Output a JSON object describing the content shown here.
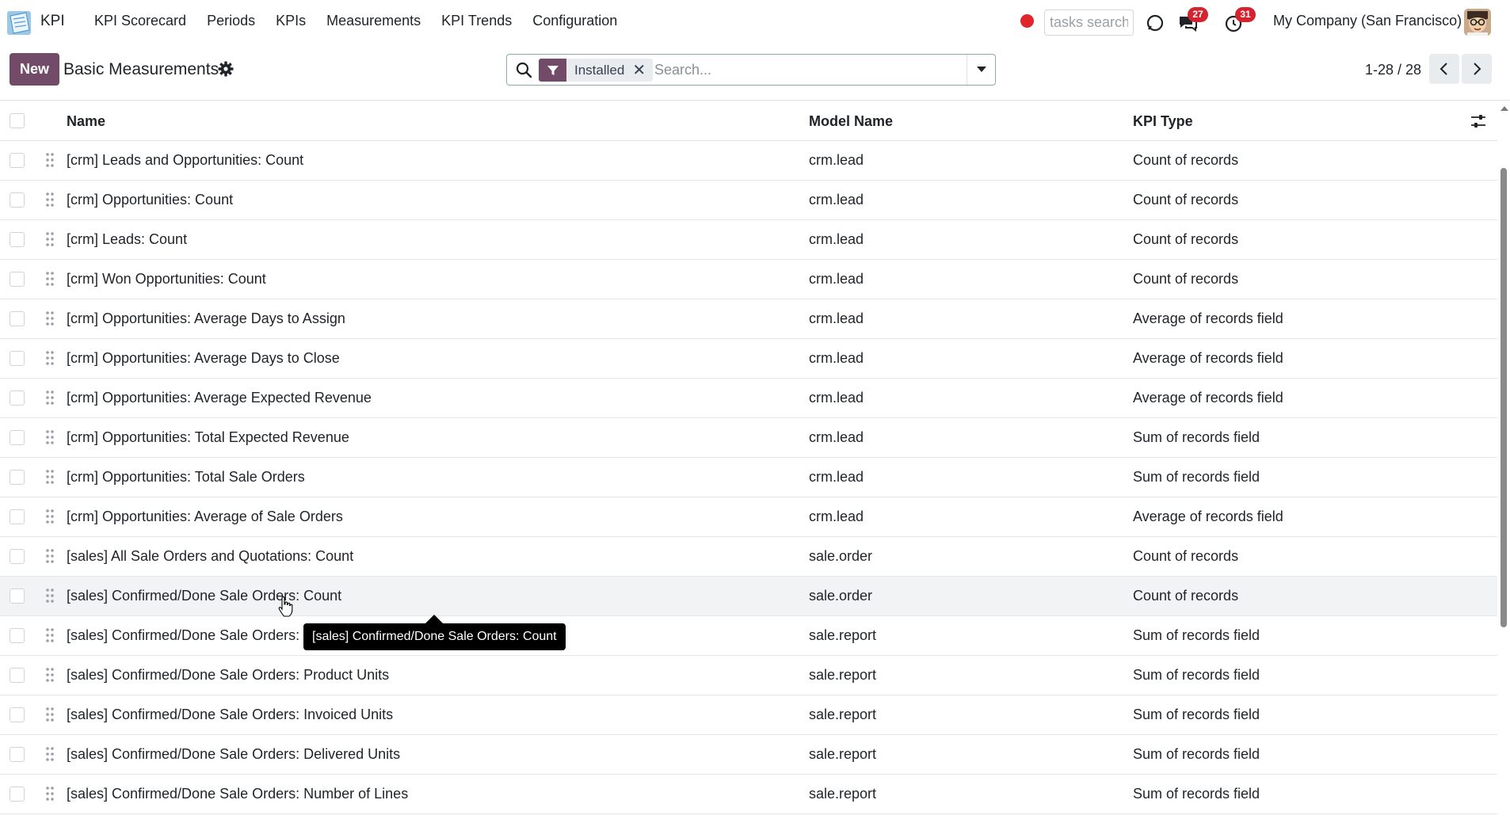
{
  "app": {
    "name": "KPI"
  },
  "menu": [
    {
      "label": "KPI Scorecard"
    },
    {
      "label": "Periods"
    },
    {
      "label": "KPIs"
    },
    {
      "label": "Measurements"
    },
    {
      "label": "KPI Trends"
    },
    {
      "label": "Configuration"
    }
  ],
  "systray": {
    "tasks_search_placeholder": "tasks search",
    "messages_count": "27",
    "activities_count": "31",
    "company": "My Company (San Francisco)"
  },
  "control": {
    "new_label": "New",
    "title": "Basic Measurements",
    "facet_label": "Installed",
    "search_placeholder": "Search...",
    "pager": "1-28 / 28"
  },
  "table": {
    "columns": [
      "Name",
      "Model Name",
      "KPI Type"
    ],
    "rows": [
      {
        "name": "[crm] Leads and Opportunities: Count",
        "model": "crm.lead",
        "type": "Count of records"
      },
      {
        "name": "[crm] Opportunities: Count",
        "model": "crm.lead",
        "type": "Count of records"
      },
      {
        "name": "[crm] Leads: Count",
        "model": "crm.lead",
        "type": "Count of records"
      },
      {
        "name": "[crm] Won Opportunities: Count",
        "model": "crm.lead",
        "type": "Count of records"
      },
      {
        "name": "[crm] Opportunities: Average Days to Assign",
        "model": "crm.lead",
        "type": "Average of records field"
      },
      {
        "name": "[crm] Opportunities: Average Days to Close",
        "model": "crm.lead",
        "type": "Average of records field"
      },
      {
        "name": "[crm] Opportunities: Average Expected Revenue",
        "model": "crm.lead",
        "type": "Average of records field"
      },
      {
        "name": "[crm] Opportunities: Total Expected Revenue",
        "model": "crm.lead",
        "type": "Sum of records field"
      },
      {
        "name": "[crm] Opportunities: Total Sale Orders",
        "model": "crm.lead",
        "type": "Sum of records field"
      },
      {
        "name": "[crm] Opportunities: Average of Sale Orders",
        "model": "crm.lead",
        "type": "Average of records field"
      },
      {
        "name": "[sales] All Sale Orders and Quotations: Count",
        "model": "sale.order",
        "type": "Count of records"
      },
      {
        "name": "[sales] Confirmed/Done Sale Orders: Count",
        "model": "sale.order",
        "type": "Count of records"
      },
      {
        "name": "[sales] Confirmed/Done Sale Orders: To",
        "model": "sale.report",
        "type": "Sum of records field"
      },
      {
        "name": "[sales] Confirmed/Done Sale Orders: Product Units",
        "model": "sale.report",
        "type": "Sum of records field"
      },
      {
        "name": "[sales] Confirmed/Done Sale Orders: Invoiced Units",
        "model": "sale.report",
        "type": "Sum of records field"
      },
      {
        "name": "[sales] Confirmed/Done Sale Orders: Delivered Units",
        "model": "sale.report",
        "type": "Sum of records field"
      },
      {
        "name": "[sales] Confirmed/Done Sale Orders: Number of Lines",
        "model": "sale.report",
        "type": "Sum of records field"
      }
    ]
  },
  "tooltip": {
    "text": "[sales] Confirmed/Done Sale Orders: Count"
  },
  "colors": {
    "brand": "#714b67",
    "badge": "#d4232f",
    "record": "#e0252c"
  }
}
